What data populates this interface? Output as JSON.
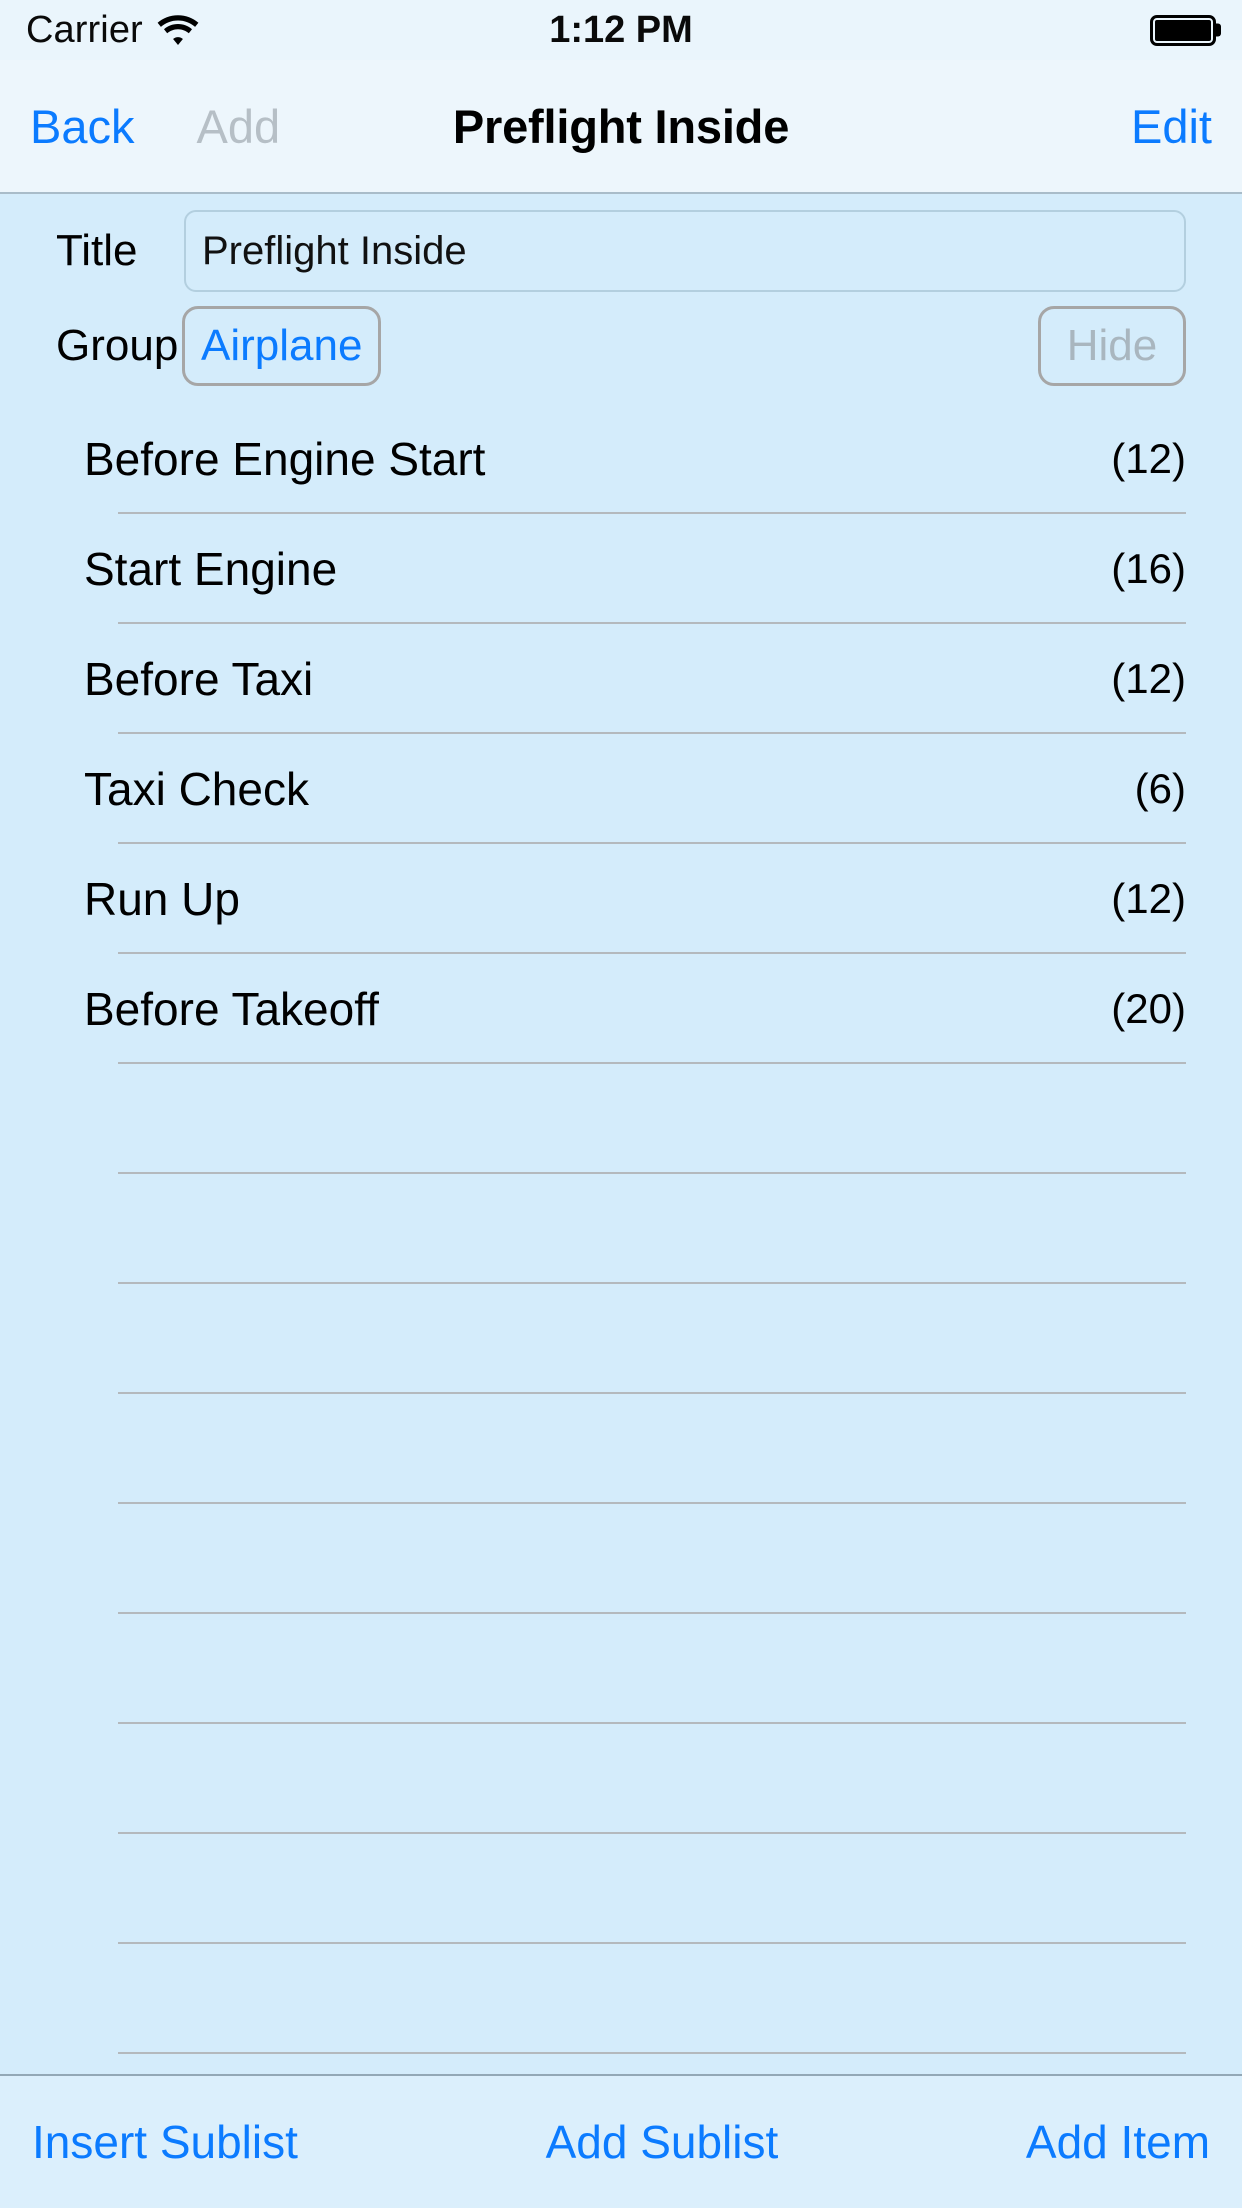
{
  "status_bar": {
    "carrier": "Carrier",
    "wifi_icon": "wifi-icon",
    "time": "1:12 PM",
    "battery_icon": "battery-full-icon"
  },
  "nav_bar": {
    "back_label": "Back",
    "add_label": "Add",
    "title": "Preflight Inside",
    "edit_label": "Edit"
  },
  "form": {
    "title_label": "Title",
    "title_value": "Preflight Inside",
    "title_placeholder": "Title",
    "group_label": "Group",
    "group_value": "Airplane",
    "hide_label": "Hide"
  },
  "list": {
    "rows": [
      {
        "title": "Before Engine Start",
        "count": "(12)"
      },
      {
        "title": "Start Engine",
        "count": "(16)"
      },
      {
        "title": "Before Taxi",
        "count": "(12)"
      },
      {
        "title": "Taxi Check",
        "count": "(6)"
      },
      {
        "title": "Run Up",
        "count": "(12)"
      },
      {
        "title": "Before Takeoff",
        "count": "(20)"
      },
      {
        "title": "",
        "count": ""
      },
      {
        "title": "",
        "count": ""
      },
      {
        "title": "",
        "count": ""
      },
      {
        "title": "",
        "count": ""
      },
      {
        "title": "",
        "count": ""
      },
      {
        "title": "",
        "count": ""
      },
      {
        "title": "",
        "count": ""
      },
      {
        "title": "",
        "count": ""
      },
      {
        "title": "",
        "count": ""
      },
      {
        "title": "",
        "count": ""
      }
    ]
  },
  "toolbar": {
    "insert_sublist_label": "Insert Sublist",
    "add_sublist_label": "Add Sublist",
    "add_item_label": "Add Item"
  },
  "colors": {
    "tint": "#0b7bff",
    "disabled": "#b6bfc6",
    "content_bg": "#d4ecfb",
    "bar_bg": "#edf6fc"
  }
}
